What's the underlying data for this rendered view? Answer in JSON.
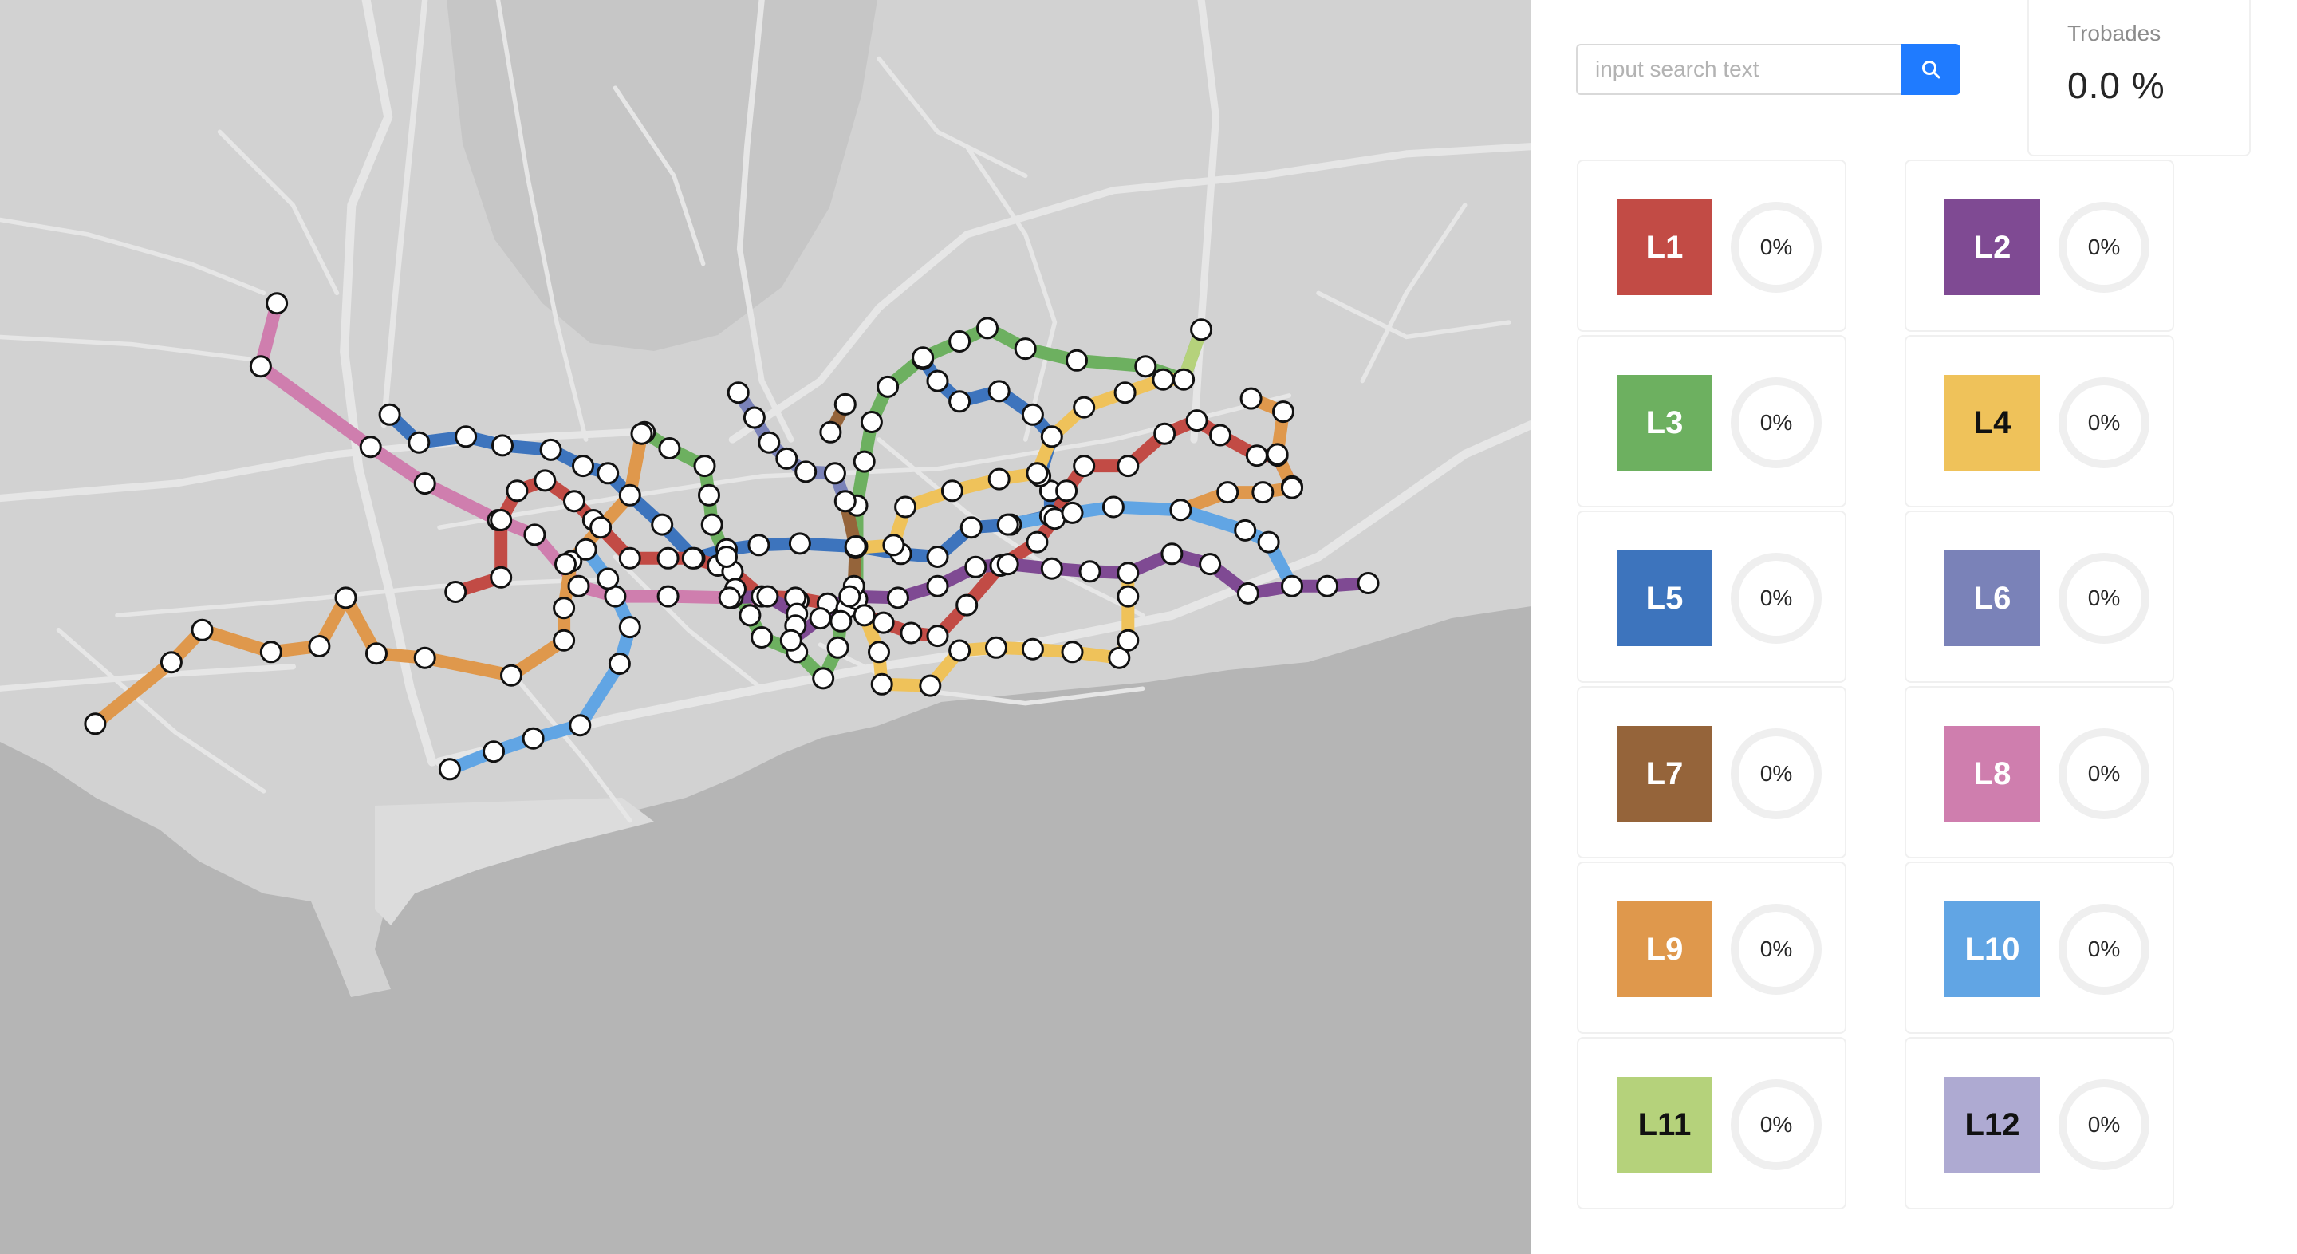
{
  "search": {
    "placeholder": "input search text"
  },
  "stats": {
    "title": "Trobades",
    "value": "0.0",
    "unit": "%"
  },
  "lines": [
    {
      "label": "L1",
      "percent": "0%",
      "color": "#c24b45",
      "text_color": "#ffffff",
      "progress": 0
    },
    {
      "label": "L2",
      "percent": "0%",
      "color": "#7f4a93",
      "text_color": "#ffffff",
      "progress": 0
    },
    {
      "label": "L3",
      "percent": "0%",
      "color": "#6db060",
      "text_color": "#ffffff",
      "progress": 0
    },
    {
      "label": "L4",
      "percent": "0%",
      "color": "#efc25a",
      "text_color": "#111111",
      "progress": 0
    },
    {
      "label": "L5",
      "percent": "0%",
      "color": "#3d74bd",
      "text_color": "#ffffff",
      "progress": 0
    },
    {
      "label": "L6",
      "percent": "0%",
      "color": "#7a82b8",
      "text_color": "#ffffff",
      "progress": 0
    },
    {
      "label": "L7",
      "percent": "0%",
      "color": "#95643a",
      "text_color": "#ffffff",
      "progress": 0
    },
    {
      "label": "L8",
      "percent": "0%",
      "color": "#cf7eae",
      "text_color": "#ffffff",
      "progress": 0
    },
    {
      "label": "L9",
      "percent": "0%",
      "color": "#df984c",
      "text_color": "#ffffff",
      "progress": 0
    },
    {
      "label": "L10",
      "percent": "0%",
      "color": "#61a5e4",
      "text_color": "#ffffff",
      "progress": 0
    },
    {
      "label": "L11",
      "percent": "0%",
      "color": "#b5d27b",
      "text_color": "#111111",
      "progress": 0
    },
    {
      "label": "L12",
      "percent": "0%",
      "color": "#aeaad2",
      "text_color": "#111111",
      "progress": 0
    }
  ],
  "icons": {
    "search_button": "search-icon"
  },
  "colors": {
    "accent": "#1f7bff",
    "map_land": "#d2d2d2",
    "map_sea": "#b5b5b5"
  }
}
